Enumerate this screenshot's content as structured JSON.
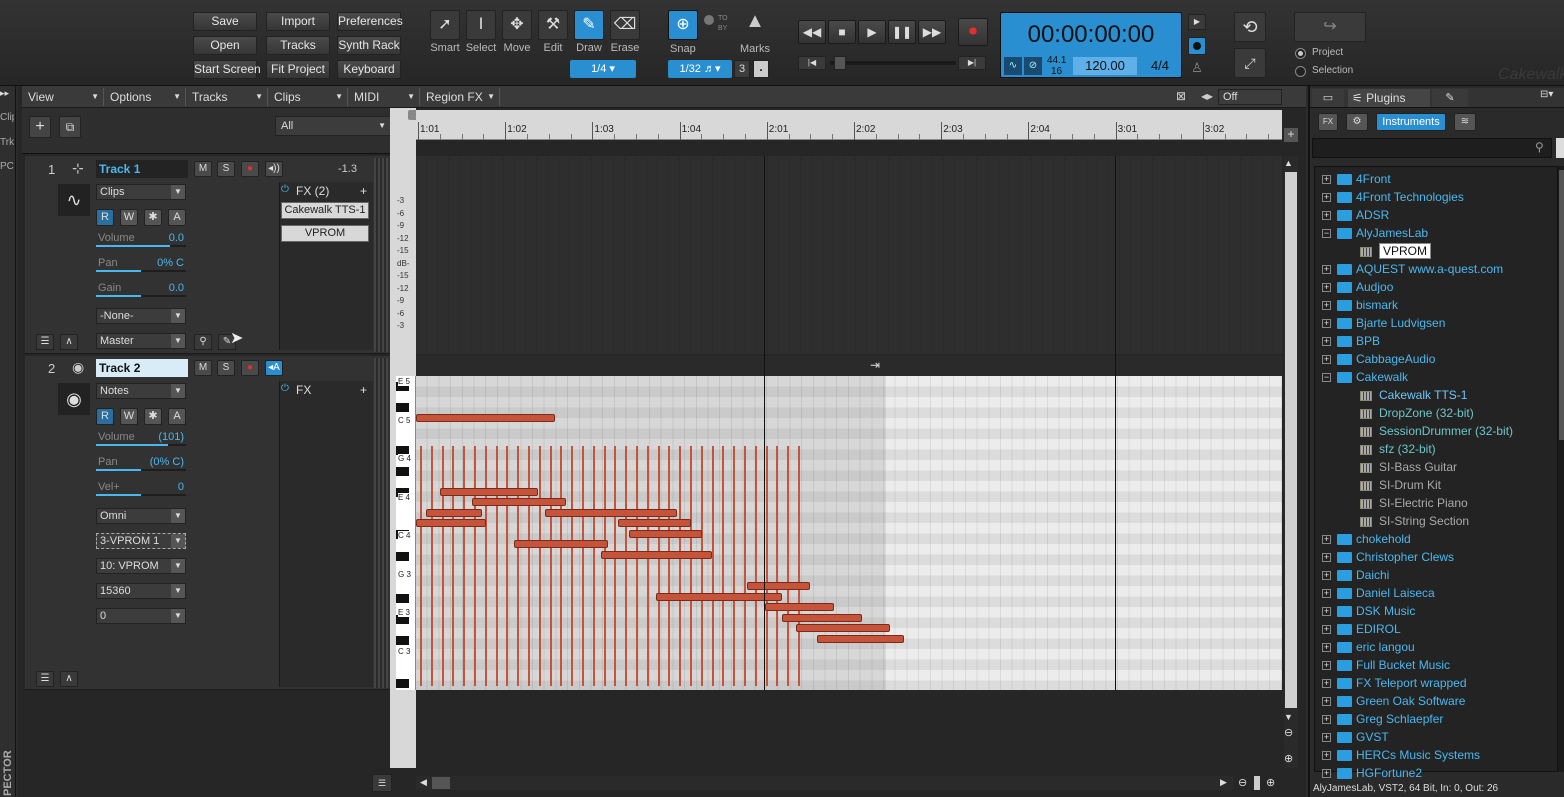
{
  "toolbar": {
    "file_buttons": [
      "Save",
      "Import",
      "Preferences",
      "Open",
      "Tracks",
      "Synth Rack",
      "Start Screen",
      "Fit Project",
      "Keyboard"
    ],
    "tools": [
      {
        "label": "Smart",
        "icon": "arrow-cursor-icon"
      },
      {
        "label": "Select",
        "icon": "ibeam-icon"
      },
      {
        "label": "Move",
        "icon": "move-icon"
      },
      {
        "label": "Edit",
        "icon": "edit-icon"
      },
      {
        "label": "Draw",
        "icon": "pencil-icon",
        "active": true
      },
      {
        "label": "Erase",
        "icon": "eraser-icon"
      }
    ],
    "draw_resolution": "1/4",
    "snap_label": "Snap",
    "snap_to_by": "TO BY",
    "snap_value": "1/32",
    "snap_triplet": "3",
    "snap_dot": ".",
    "marks_label": "Marks"
  },
  "transport": {
    "time": "00:00:00:00",
    "sample_rate": "44.1",
    "bit_depth": "16",
    "tempo": "120.00",
    "meter": "4/4"
  },
  "export": {
    "project_label": "Project",
    "selection_label": "Selection"
  },
  "menus": [
    "View",
    "Options",
    "Tracks",
    "Clips",
    "MIDI",
    "Region FX"
  ],
  "filter_value": "All",
  "timeline": {
    "ticks": [
      "1:01",
      "1:02",
      "1:03",
      "1:04",
      "2:01",
      "2:02",
      "2:03",
      "2:04",
      "3:01",
      "3:02"
    ],
    "off_label": "Off"
  },
  "track1": {
    "number": "1",
    "name": "Track 1",
    "volume_readout": "-1.3",
    "view": "Clips",
    "volume_label": "Volume",
    "volume_val": "0.0",
    "volume_level": 0.82,
    "pan_label": "Pan",
    "pan_val": "0% C",
    "pan_level": 0.5,
    "gain_label": "Gain",
    "gain_val": "0.0",
    "gain_level": 0.5,
    "input": "-None-",
    "output": "Master",
    "fx_header": "FX (2)",
    "fx_items": [
      "Cakewalk TTS-1",
      "VPROM"
    ],
    "meter_labels": [
      "-3",
      "-6",
      "-9",
      "-12",
      "-15",
      "dB-",
      "-15",
      "-12",
      "-9",
      "-6",
      "-3"
    ]
  },
  "track2": {
    "number": "2",
    "name": "Track 2",
    "view": "Notes",
    "volume_label": "Volume",
    "volume_val": "(101)",
    "volume_level": 0.8,
    "pan_label": "Pan",
    "pan_val": "(0% C)",
    "pan_level": 0.5,
    "vel_label": "Vel+",
    "vel_val": "0",
    "vel_level": 0.5,
    "input": "Omni",
    "output": "3-VPROM 1",
    "channel": "10: VPROM",
    "bank": "15360",
    "patch": "0",
    "fx_header": "FX",
    "piano_labels": [
      "E 5",
      "C 5",
      "G 4",
      "E 4",
      "C 4",
      "G 3",
      "E 3",
      "C 3"
    ]
  },
  "track_buttons": {
    "mute": "M",
    "solo": "S",
    "read": "R",
    "write": "W",
    "star": "✱",
    "auto": "A"
  },
  "browser": {
    "tab_plugins": "Plugins",
    "sub_fx": "FX",
    "sub_instruments": "Instruments",
    "tree": [
      {
        "name": "4Front",
        "type": "folder"
      },
      {
        "name": "4Front Technologies",
        "type": "folder"
      },
      {
        "name": "ADSR",
        "type": "folder"
      },
      {
        "name": "AlyJamesLab",
        "type": "folder-open"
      },
      {
        "name": "VPROM",
        "type": "plugin",
        "selected": true
      },
      {
        "name": "AQUEST www.a-quest.com",
        "type": "folder"
      },
      {
        "name": "Audjoo",
        "type": "folder"
      },
      {
        "name": "bismark",
        "type": "folder"
      },
      {
        "name": "Bjarte Ludvigsen",
        "type": "folder"
      },
      {
        "name": "BPB",
        "type": "folder"
      },
      {
        "name": "CabbageAudio",
        "type": "folder"
      },
      {
        "name": "Cakewalk",
        "type": "folder-open"
      },
      {
        "name": "Cakewalk TTS-1",
        "type": "plugin"
      },
      {
        "name": "DropZone (32-bit)",
        "type": "plugin-green"
      },
      {
        "name": "SessionDrummer (32-bit)",
        "type": "plugin-green"
      },
      {
        "name": "sfz (32-bit)",
        "type": "plugin-green"
      },
      {
        "name": "SI-Bass Guitar",
        "type": "plugin-gray"
      },
      {
        "name": "SI-Drum Kit",
        "type": "plugin-gray"
      },
      {
        "name": "SI-Electric Piano",
        "type": "plugin-gray"
      },
      {
        "name": "SI-String Section",
        "type": "plugin-gray"
      },
      {
        "name": "chokehold",
        "type": "folder"
      },
      {
        "name": "Christopher Clews",
        "type": "folder"
      },
      {
        "name": "Daichi",
        "type": "folder"
      },
      {
        "name": "Daniel Laiseca",
        "type": "folder"
      },
      {
        "name": "DSK Music",
        "type": "folder"
      },
      {
        "name": "EDIROL",
        "type": "folder"
      },
      {
        "name": "eric langou",
        "type": "folder"
      },
      {
        "name": "Full Bucket Music",
        "type": "folder"
      },
      {
        "name": "FX Teleport wrapped",
        "type": "folder"
      },
      {
        "name": "Green Oak Software",
        "type": "folder"
      },
      {
        "name": "Greg Schlaepfer",
        "type": "folder"
      },
      {
        "name": "GVST",
        "type": "folder"
      },
      {
        "name": "HERCs Music Systems",
        "type": "folder"
      },
      {
        "name": "HGFortune2",
        "type": "folder"
      }
    ],
    "status": "AlyJamesLab, VST2, 64 Bit, In: 0, Out: 26"
  },
  "inspector": {
    "tabs": [
      "Clip",
      "Trk",
      "PC"
    ],
    "label": "PECTOR"
  },
  "watermark": "Cakewalk",
  "notes": [
    {
      "x0": 0.0,
      "x1": 0.4,
      "p": 4
    },
    {
      "x0": 0.07,
      "x1": 0.35,
      "p": 11
    },
    {
      "x0": 0.16,
      "x1": 0.43,
      "p": 12
    },
    {
      "x0": 0.03,
      "x1": 0.19,
      "p": 13
    },
    {
      "x0": 0.0,
      "x1": 0.2,
      "p": 14
    },
    {
      "x0": 0.37,
      "x1": 0.75,
      "p": 13
    },
    {
      "x0": 0.61,
      "x1": 0.82,
      "p": 15
    },
    {
      "x0": 0.58,
      "x1": 0.79,
      "p": 14
    },
    {
      "x0": 0.28,
      "x1": 0.55,
      "p": 16
    },
    {
      "x0": 0.53,
      "x1": 0.85,
      "p": 17
    },
    {
      "x0": 0.95,
      "x1": 1.13,
      "p": 20
    },
    {
      "x0": 0.69,
      "x1": 1.05,
      "p": 21
    },
    {
      "x0": 1.0,
      "x1": 1.2,
      "p": 22
    },
    {
      "x0": 1.05,
      "x1": 1.28,
      "p": 23
    },
    {
      "x0": 1.09,
      "x1": 1.36,
      "p": 24
    },
    {
      "x0": 1.15,
      "x1": 1.4,
      "p": 25
    }
  ]
}
